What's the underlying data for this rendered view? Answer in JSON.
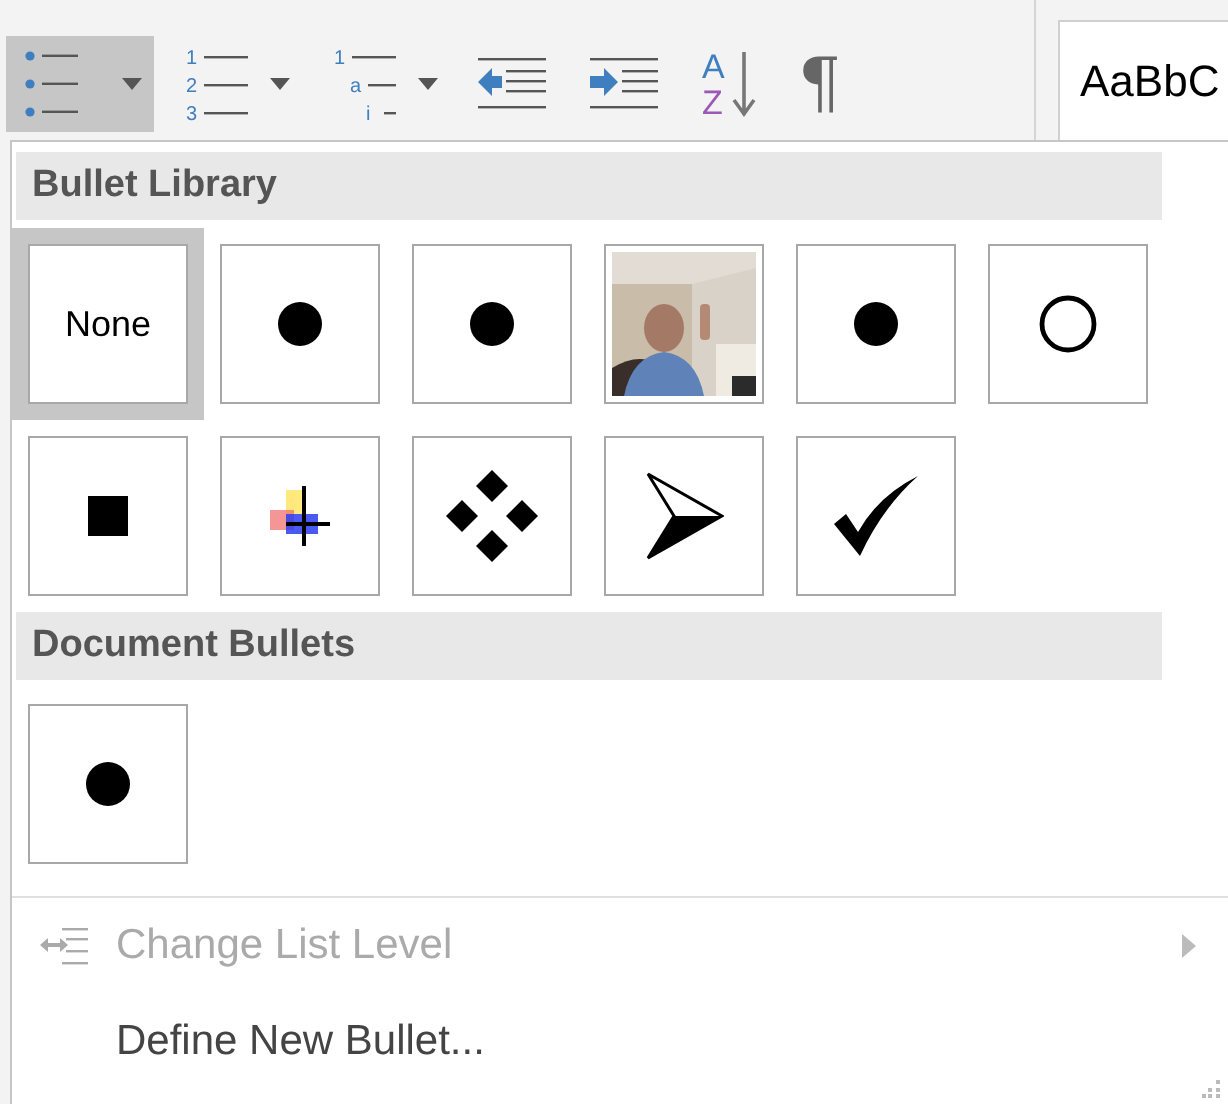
{
  "toolbar": {
    "buttons": [
      {
        "kind": "bullets",
        "selected": true,
        "dropdown": true
      },
      {
        "kind": "numbering",
        "selected": false,
        "dropdown": true,
        "markers": [
          "1",
          "2",
          "3"
        ]
      },
      {
        "kind": "multilevel",
        "selected": false,
        "dropdown": true,
        "markers": [
          "1",
          "a",
          "i"
        ]
      },
      {
        "kind": "outdent",
        "selected": false,
        "dropdown": false
      },
      {
        "kind": "indent",
        "selected": false,
        "dropdown": false
      },
      {
        "kind": "sort",
        "selected": false,
        "dropdown": false,
        "markers": [
          "A",
          "Z"
        ]
      },
      {
        "kind": "pilcrow",
        "selected": false,
        "dropdown": false,
        "markers": [
          "¶"
        ]
      }
    ],
    "style_preview": "AaBbC"
  },
  "menu": {
    "sections": [
      {
        "title": "Bullet Library",
        "items": [
          {
            "kind": "text",
            "label": "None",
            "selected": true
          },
          {
            "kind": "dot",
            "selected": false
          },
          {
            "kind": "dot",
            "selected": false
          },
          {
            "kind": "picture",
            "selected": false
          },
          {
            "kind": "dot",
            "selected": false
          },
          {
            "kind": "circle",
            "selected": false
          },
          {
            "kind": "square",
            "selected": false
          },
          {
            "kind": "colorful",
            "selected": false
          },
          {
            "kind": "diamonds",
            "selected": false
          },
          {
            "kind": "arrow",
            "selected": false
          },
          {
            "kind": "check",
            "selected": false
          }
        ]
      },
      {
        "title": "Document Bullets",
        "items": [
          {
            "kind": "dot",
            "selected": false
          }
        ]
      }
    ],
    "commands": [
      {
        "kind": "level",
        "label": "Change List Level",
        "disabled": true,
        "submenu": true
      },
      {
        "kind": "define",
        "label": "Define New Bullet...",
        "disabled": false,
        "submenu": false
      }
    ]
  }
}
